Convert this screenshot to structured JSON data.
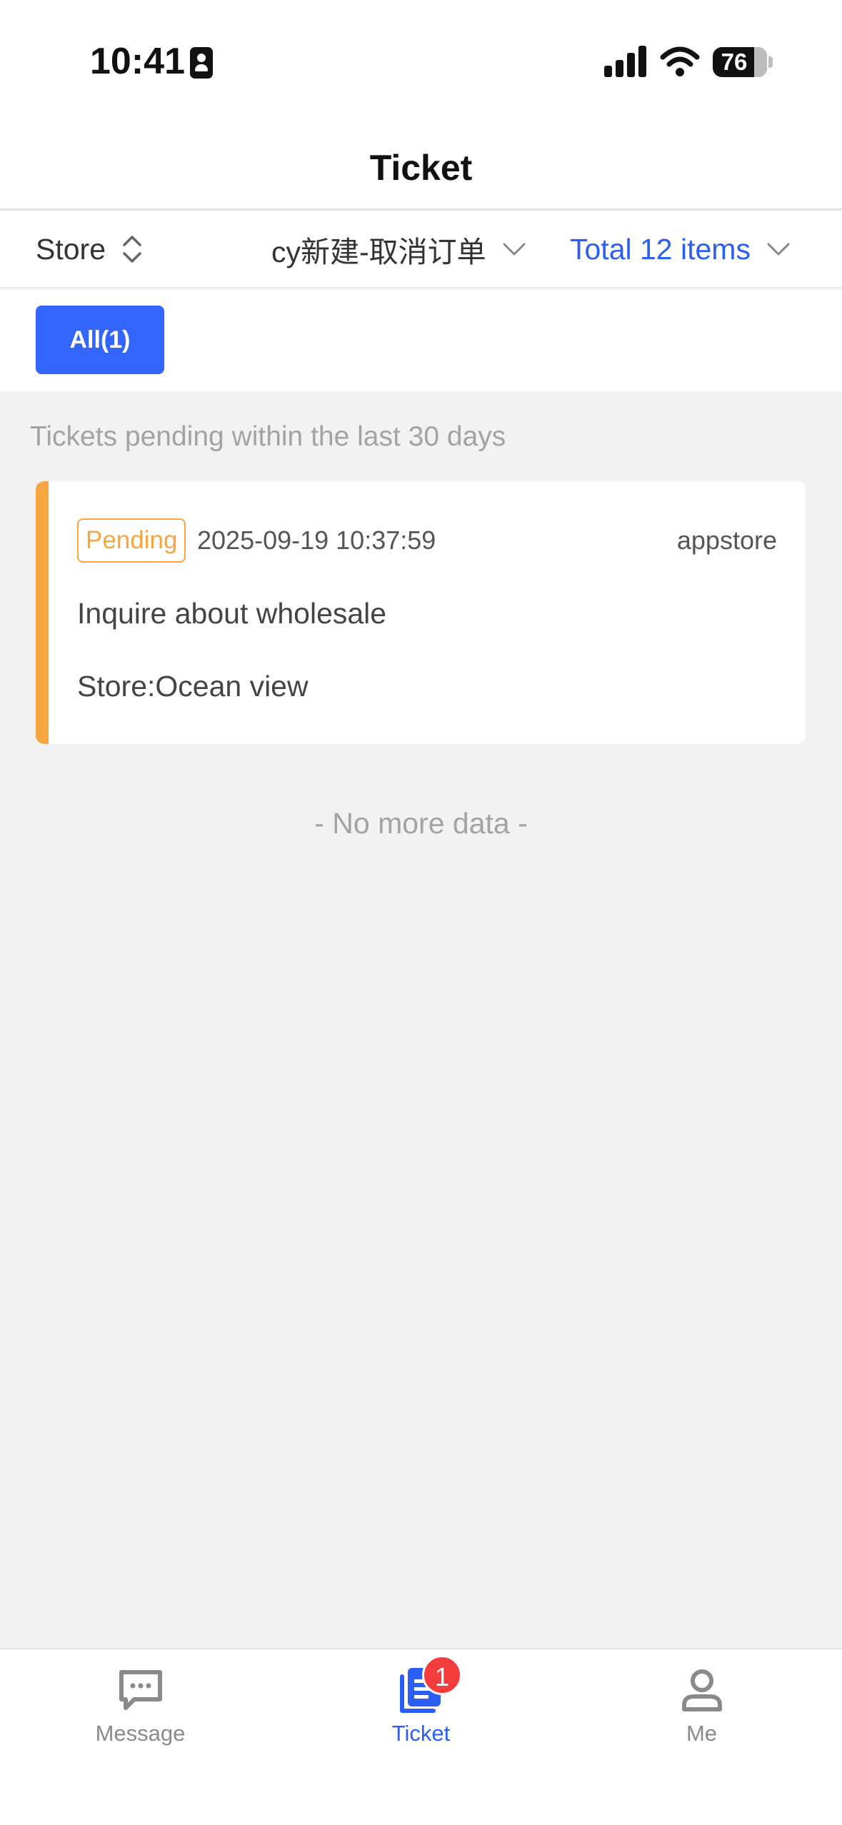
{
  "status_bar": {
    "time": "10:41",
    "battery": "76"
  },
  "nav": {
    "title": "Ticket"
  },
  "filters": {
    "store_label": "Store",
    "selected_label": "cy新建-取消订单",
    "total_label": "Total 12 items",
    "accent_color": "#2a5ef5"
  },
  "tabs": [
    {
      "label": "All(1)",
      "active": true
    }
  ],
  "list": {
    "hint": "Tickets pending within the last 30 days",
    "tickets": [
      {
        "status": "Pending",
        "status_color": "#f7a540",
        "time": "2025-09-19 10:37:59",
        "source": "appstore",
        "subject": "Inquire about wholesale",
        "store": "Store:Ocean view"
      }
    ],
    "footer": "- No more data -"
  },
  "tab_bar": {
    "items": [
      {
        "label": "Message",
        "icon": "message-icon",
        "active": false
      },
      {
        "label": "Ticket",
        "icon": "ticket-icon",
        "active": true,
        "badge": "1"
      },
      {
        "label": "Me",
        "icon": "person-icon",
        "active": false
      }
    ]
  }
}
